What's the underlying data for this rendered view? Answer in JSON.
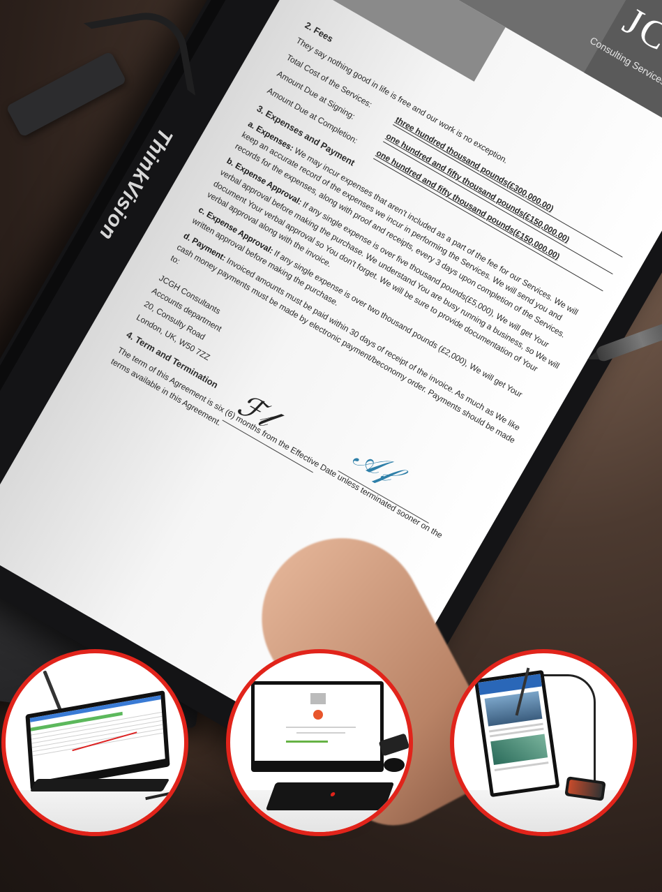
{
  "photo": {
    "brand": "ThinkVision",
    "accent_colors": {
      "ring": "#e1241b",
      "signature_blue": "#2e7fa8"
    }
  },
  "document": {
    "logo": "JCGH",
    "subtitle": "Consulting Services Agreement",
    "fees": {
      "title": "2. Fees",
      "intro": "They say nothing good in life is free and our work is no exception.",
      "rows": [
        {
          "label": "Total Cost of the Services:",
          "value": "three hundred thousand pounds(£300,000.00)"
        },
        {
          "label": "Amount Due at Signing:",
          "value": "one hundred and fifty thousand pounds(£150,000.00)"
        },
        {
          "label": "Amount Due at Completion:",
          "value": "one hundred and fifty thousand pounds(£150,000.00)"
        }
      ]
    },
    "expenses": {
      "title": "3. Expenses and Payment",
      "items": [
        {
          "lead": "a. Expenses:",
          "text": "We may incur expenses that aren't included as a part of the fee for our Services. We will keep an accurate record of the expenses we incur in performing the Services. We will send you and records for the expenses, along with proof and receipts, every 3 days upon completion of the Services."
        },
        {
          "lead": "b. Expense Approval:",
          "text": "If any single expense is over five thousand pounds(£5,000), We will get Your verbal approval before making the purchase. We understand You are busy running a business, so We will document Your verbal approval so You don't forget. We will be sure to provide documentation of Your verbal approval along with the invoice."
        },
        {
          "lead": "c. Expense Approval:",
          "text": "If any single expense is over two thousand pounds (£2,000), We will get Your written approval before making the purchase."
        },
        {
          "lead": "d. Payment:",
          "text": "Invoiced amounts must be paid within 30 days of receipt of the invoice. As much as We like cash money payments must be made by electronic payment/beconomy order. Payments should be made to:"
        }
      ]
    },
    "address": [
      "JCGH Consultants",
      "Accounts department",
      "20, Consulty Road",
      "London, UK, W50 7ZZ"
    ],
    "term": {
      "title": "4. Term and Termination",
      "text": "The term of this Agreement is six (6) months from the Effective Date unless terminated sooner on the terms available in this Agreement."
    }
  }
}
